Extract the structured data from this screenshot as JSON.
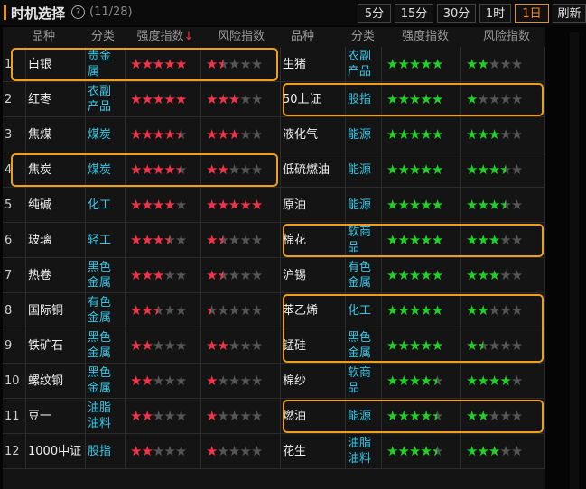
{
  "header": {
    "title": "时机选择",
    "count": "(11/28)",
    "help_icon": "?"
  },
  "toolbar": {
    "buttons": [
      "5分",
      "15分",
      "30分",
      "1时",
      "1日",
      "刷新"
    ],
    "active": "1日"
  },
  "columns": {
    "no": "",
    "name": "品种",
    "cat": "分类",
    "strength": "强度指数",
    "sort_icon": "↓",
    "risk": "风险指数"
  },
  "colors": {
    "accent": "#e8902a",
    "red_star": "#f2334a",
    "green_star": "#1fd324",
    "category": "#36c8e8",
    "highlight": "#f0a018"
  },
  "rows": [
    {
      "no": "1",
      "l": {
        "name": "白银",
        "cat": [
          "贵金",
          "属"
        ],
        "strength": 5,
        "risk": 1.5
      },
      "r": {
        "name": "生猪",
        "cat": [
          "农副",
          "产品"
        ],
        "strength": 5,
        "risk": 2
      }
    },
    {
      "no": "2",
      "l": {
        "name": "红枣",
        "cat": [
          "农副",
          "产品"
        ],
        "strength": 5,
        "risk": 3
      },
      "r": {
        "name": "50上证",
        "cat": [
          "股指"
        ],
        "strength": 5,
        "risk": 1
      }
    },
    {
      "no": "3",
      "l": {
        "name": "焦煤",
        "cat": [
          "煤炭"
        ],
        "strength": 4.5,
        "risk": 3
      },
      "r": {
        "name": "液化气",
        "cat": [
          "能源"
        ],
        "strength": 5,
        "risk": 3
      }
    },
    {
      "no": "4",
      "l": {
        "name": "焦炭",
        "cat": [
          "煤炭"
        ],
        "strength": 4.5,
        "risk": 2
      },
      "r": {
        "name": "低硫燃油",
        "cat": [
          "能源"
        ],
        "strength": 5,
        "risk": 3.5
      }
    },
    {
      "no": "5",
      "l": {
        "name": "纯碱",
        "cat": [
          "化工"
        ],
        "strength": 4,
        "risk": 5
      },
      "r": {
        "name": "原油",
        "cat": [
          "能源"
        ],
        "strength": 5,
        "risk": 3.5
      }
    },
    {
      "no": "6",
      "l": {
        "name": "玻璃",
        "cat": [
          "轻工"
        ],
        "strength": 3.5,
        "risk": 1.5
      },
      "r": {
        "name": "棉花",
        "cat": [
          "软商",
          "品"
        ],
        "strength": 5,
        "risk": 3
      }
    },
    {
      "no": "7",
      "l": {
        "name": "热卷",
        "cat": [
          "黑色",
          "金属"
        ],
        "strength": 3,
        "risk": 1.5
      },
      "r": {
        "name": "沪锡",
        "cat": [
          "有色",
          "金属"
        ],
        "strength": 5,
        "risk": 3
      }
    },
    {
      "no": "8",
      "l": {
        "name": "国际铜",
        "cat": [
          "有色",
          "金属"
        ],
        "strength": 2.5,
        "risk": 0.5
      },
      "r": {
        "name": "苯乙烯",
        "cat": [
          "化工"
        ],
        "strength": 5,
        "risk": 2
      }
    },
    {
      "no": "9",
      "l": {
        "name": "铁矿石",
        "cat": [
          "黑色",
          "金属"
        ],
        "strength": 2,
        "risk": 2
      },
      "r": {
        "name": "锰硅",
        "cat": [
          "黑色",
          "金属"
        ],
        "strength": 5,
        "risk": 1.5
      }
    },
    {
      "no": "10",
      "l": {
        "name": "螺纹钢",
        "cat": [
          "黑色",
          "金属"
        ],
        "strength": 2,
        "risk": 1
      },
      "r": {
        "name": "棉纱",
        "cat": [
          "软商",
          "品"
        ],
        "strength": 4.5,
        "risk": 4
      }
    },
    {
      "no": "11",
      "l": {
        "name": "豆一",
        "cat": [
          "油脂",
          "油料"
        ],
        "strength": 2,
        "risk": 1
      },
      "r": {
        "name": "燃油",
        "cat": [
          "能源"
        ],
        "strength": 4.5,
        "risk": 2
      }
    },
    {
      "no": "12",
      "l": {
        "name": "1000中证",
        "cat": [
          "股指"
        ],
        "strength": 2,
        "risk": 1
      },
      "r": {
        "name": "花生",
        "cat": [
          "油脂",
          "油料"
        ],
        "strength": 4.5,
        "risk": 3
      }
    }
  ],
  "highlights": [
    {
      "side": "l",
      "rows": [
        1,
        1
      ]
    },
    {
      "side": "l",
      "rows": [
        4,
        4
      ]
    },
    {
      "side": "r",
      "rows": [
        2,
        2
      ]
    },
    {
      "side": "r",
      "rows": [
        6,
        6
      ]
    },
    {
      "side": "r",
      "rows": [
        8,
        9
      ]
    },
    {
      "side": "r",
      "rows": [
        11,
        11
      ]
    }
  ]
}
